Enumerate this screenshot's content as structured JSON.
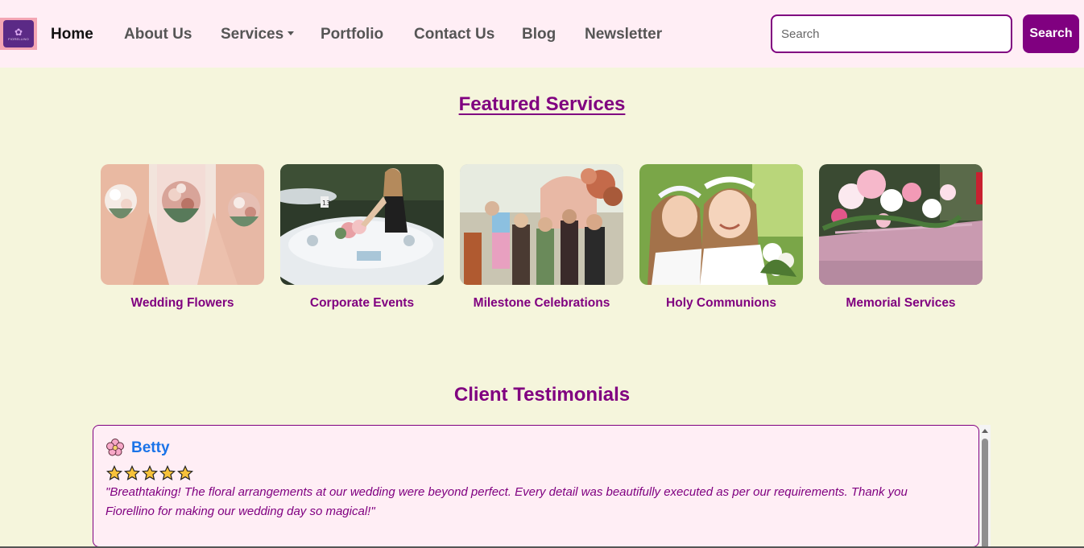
{
  "brand": {
    "logo_text": "FIORELLINO",
    "logo_icon": "flower-logo-icon"
  },
  "nav": {
    "items": [
      {
        "label": "Home",
        "active": true
      },
      {
        "label": "About Us"
      },
      {
        "label": "Services",
        "dropdown": true
      },
      {
        "label": "Portfolio"
      },
      {
        "label": "Contact Us"
      },
      {
        "label": "Blog"
      },
      {
        "label": "Newsletter"
      }
    ]
  },
  "search": {
    "placeholder": "Search",
    "value": "",
    "button_label": "Search"
  },
  "featured": {
    "title": "Featured Services",
    "cards": [
      {
        "label": "Wedding Flowers",
        "image": "bridesmaids-bouquets-photo"
      },
      {
        "label": "Corporate Events",
        "image": "event-table-setup-photo"
      },
      {
        "label": "Milestone Celebrations",
        "image": "party-celebration-photo"
      },
      {
        "label": "Holy Communions",
        "image": "girls-flower-crowns-photo"
      },
      {
        "label": "Memorial Services",
        "image": "casket-flowers-photo"
      }
    ]
  },
  "testimonials": {
    "title": "Client Testimonials",
    "items": [
      {
        "name": "Betty",
        "icon": "cherry-blossom-icon",
        "rating": 5,
        "quote": "\"Breathtaking! The floral arrangements at our wedding were beyond perfect. Every detail was beautifully executed as per our requirements. Thank you Fiorellino for making our wedding day so magical!\""
      }
    ]
  },
  "colors": {
    "accent": "#800080",
    "page_bg": "#f5f5dc",
    "nav_bg": "#ffeef5",
    "name_link": "#1a73e8",
    "star": "#f7c23a"
  }
}
